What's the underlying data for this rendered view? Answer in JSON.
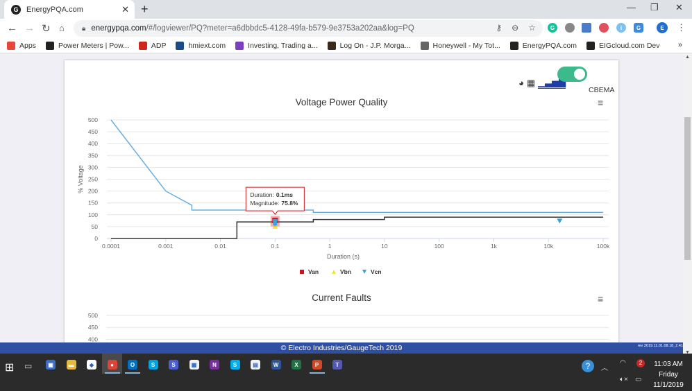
{
  "browser": {
    "tab_title": "EnergyPQA.com",
    "tab_favicon": "G",
    "new_tab": "+",
    "window_controls": {
      "minimize": "—",
      "restore": "❐",
      "close": "✕"
    },
    "url_host": "energypqa.com",
    "url_path": "/#/logviewer/PQ?meter=a6dbbdc5-4128-49fa-b579-9e3753a202aa&log=PQ",
    "profile_initial": "E",
    "bookmarks": [
      {
        "label": "Apps",
        "icon": "apps-grid-icon",
        "color": "#e8453c"
      },
      {
        "label": "Power Meters | Pow...",
        "icon": "eig-logo-icon",
        "color": "#222222"
      },
      {
        "label": "ADP",
        "icon": "adp-logo-icon",
        "color": "#d0271d"
      },
      {
        "label": "hmiext.com",
        "icon": "hmiext-icon",
        "color": "#1a4a8a"
      },
      {
        "label": "Investing, Trading a...",
        "icon": "investing-star-icon",
        "color": "#7b3fbf"
      },
      {
        "label": "Log On - J.P. Morga...",
        "icon": "jpm-icon",
        "color": "#3a2a1a"
      },
      {
        "label": "Honeywell - My Tot...",
        "icon": "globe-icon",
        "color": "#666666"
      },
      {
        "label": "EnergyPQA.com",
        "icon": "eig-logo-icon",
        "color": "#222222"
      },
      {
        "label": "EIGcloud.com Dev",
        "icon": "eig-logo-icon",
        "color": "#222222"
      }
    ],
    "bookmarks_more": "»"
  },
  "toolbar": {
    "cbema_toggle_on": true,
    "cbema_label": "CBEMA",
    "accent": "#3dba8c"
  },
  "chart_data": [
    {
      "type": "line",
      "title": "Voltage Power Quality",
      "xlabel": "Duration (s)",
      "ylabel": "% Voltage",
      "xscale": "log",
      "xlim": [
        0.0001,
        100000
      ],
      "ylim": [
        0,
        500
      ],
      "x_ticks": [
        {
          "v": 0.0001,
          "label": "0.0001"
        },
        {
          "v": 0.001,
          "label": "0.001"
        },
        {
          "v": 0.01,
          "label": "0.01"
        },
        {
          "v": 0.1,
          "label": "0.1"
        },
        {
          "v": 1,
          "label": "1"
        },
        {
          "v": 10,
          "label": "10"
        },
        {
          "v": 100,
          "label": "100"
        },
        {
          "v": 1000,
          "label": "1k"
        },
        {
          "v": 10000,
          "label": "10k"
        },
        {
          "v": 100000,
          "label": "100k"
        }
      ],
      "y_ticks": [
        0,
        50,
        100,
        150,
        200,
        250,
        300,
        350,
        400,
        450,
        500
      ],
      "grid": true,
      "curves": [
        {
          "name": "CBEMA upper",
          "color": "#6aaee0",
          "points": [
            [
              0.0001,
              500
            ],
            [
              0.001,
              200
            ],
            [
              0.003,
              140
            ],
            [
              0.003,
              120
            ],
            [
              0.5,
              120
            ],
            [
              0.5,
              110
            ],
            [
              100000,
              110
            ]
          ]
        },
        {
          "name": "CBEMA lower",
          "color": "#333333",
          "points": [
            [
              0.0001,
              0
            ],
            [
              0.02,
              0
            ],
            [
              0.02,
              70
            ],
            [
              0.5,
              70
            ],
            [
              0.5,
              80
            ],
            [
              10,
              80
            ],
            [
              10,
              90
            ],
            [
              100000,
              90
            ]
          ]
        }
      ],
      "series": [
        {
          "name": "Van",
          "marker": "square",
          "color": "#d0141d",
          "points": [
            [
              0.1,
              75.8
            ]
          ]
        },
        {
          "name": "Vbn",
          "marker": "triangle-up",
          "color": "#f3e43a",
          "points": [
            [
              0.1,
              50
            ]
          ]
        },
        {
          "name": "Vcn",
          "marker": "triangle-down",
          "color": "#36a2d8",
          "points": [
            [
              0.1,
              70
            ],
            [
              16000,
              75
            ]
          ]
        }
      ],
      "legend": {
        "position": "bottom-center",
        "entries": [
          "Van",
          "Vbn",
          "Vcn"
        ]
      },
      "tooltip": {
        "duration_label": "Duration:",
        "duration_value": "0.1ms",
        "magnitude_label": "Magnitude:",
        "magnitude_value": "75.8%"
      }
    },
    {
      "type": "line",
      "title": "Current Faults",
      "ylim": [
        0,
        500
      ],
      "y_ticks_visible": [
        500,
        450,
        400
      ],
      "grid": true
    }
  ],
  "footer": {
    "copyright": "© Electro Industries/GaugeTech 2019",
    "revision": "rev 2019.11.01.08.18_2.41"
  },
  "taskbar": {
    "apps": [
      {
        "name": "network-computer",
        "color": "#3b6fc4",
        "glyph": "▣"
      },
      {
        "name": "file-explorer",
        "color": "#e7b93a",
        "glyph": "▬"
      },
      {
        "name": "dropbox",
        "color": "#ffffff",
        "glyph": "◆"
      },
      {
        "name": "chrome",
        "color": "#db4437",
        "glyph": "●",
        "active": true
      },
      {
        "name": "outlook",
        "color": "#0072c6",
        "glyph": "O",
        "running": true
      },
      {
        "name": "skype-business",
        "color": "#00a1e0",
        "glyph": "S"
      },
      {
        "name": "snagit",
        "color": "#4a5dd1",
        "glyph": "S"
      },
      {
        "name": "calendar-app",
        "color": "#f2f2f2",
        "glyph": "▦"
      },
      {
        "name": "onenote",
        "color": "#7b2f9e",
        "glyph": "N"
      },
      {
        "name": "skype",
        "color": "#00aff0",
        "glyph": "S"
      },
      {
        "name": "store",
        "color": "#f2f2f2",
        "glyph": "▤"
      },
      {
        "name": "word",
        "color": "#2b579a",
        "glyph": "W"
      },
      {
        "name": "excel",
        "color": "#217346",
        "glyph": "X"
      },
      {
        "name": "powerpoint",
        "color": "#d24726",
        "glyph": "P",
        "running": true
      },
      {
        "name": "teams",
        "color": "#5558af",
        "glyph": "T"
      }
    ],
    "time": "11:03 AM",
    "day": "Friday",
    "date": "11/1/2019",
    "notification_badge": "2"
  }
}
